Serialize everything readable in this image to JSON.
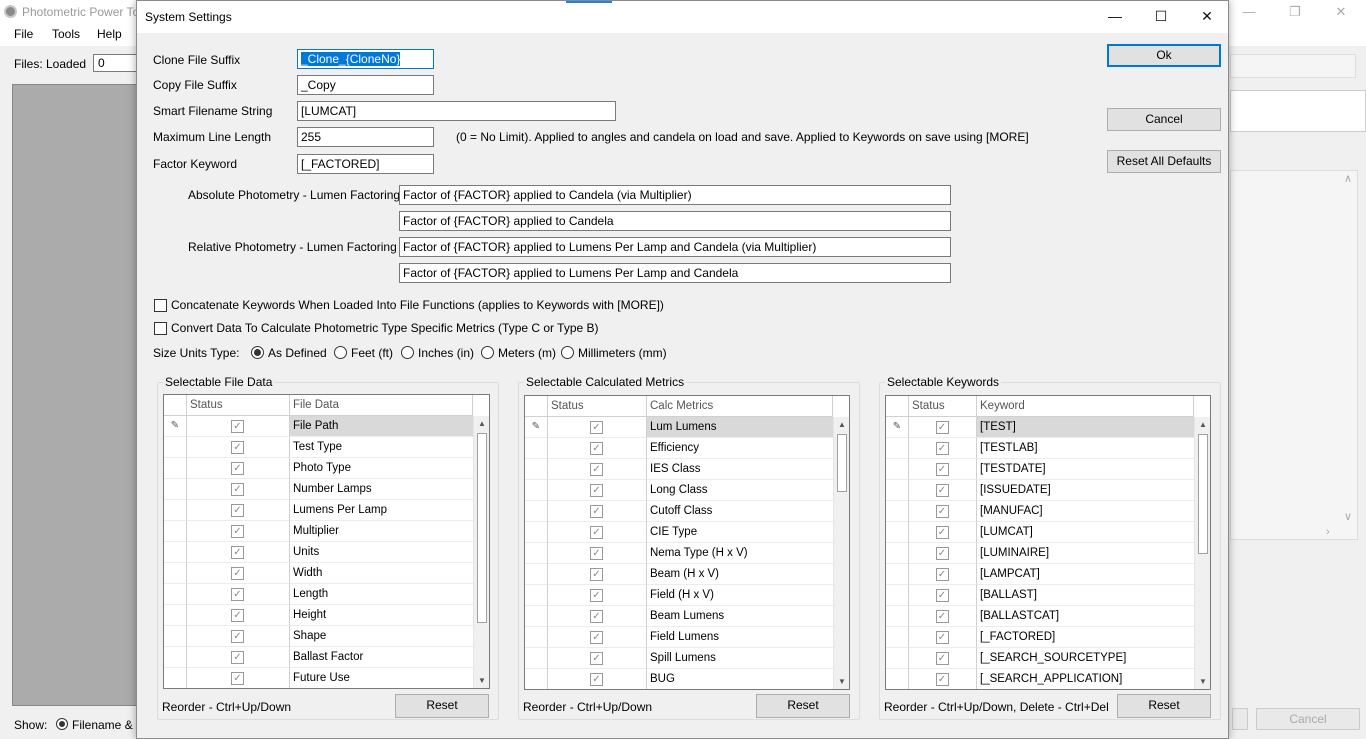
{
  "bg_app": {
    "title": "Photometric Power To",
    "menu": [
      "File",
      "Tools",
      "Help"
    ],
    "files_loaded_label": "Files: Loaded",
    "files_loaded_value": "0",
    "show_label": "Show:",
    "show_option": "Filename & D",
    "cancel_label": "Cancel"
  },
  "dialog": {
    "title": "System Settings",
    "fields": {
      "clone_suffix_label": "Clone File Suffix",
      "clone_suffix_value": "_Clone_{CloneNo}",
      "copy_suffix_label": "Copy File Suffix",
      "copy_suffix_value": "_Copy",
      "smart_filename_label": "Smart Filename String",
      "smart_filename_value": "[LUMCAT]",
      "max_line_label": "Maximum Line Length",
      "max_line_value": "255",
      "max_line_note": "(0 = No Limit). Applied to angles and candela on load and save. Applied to Keywords on save using [MORE]",
      "factor_keyword_label": "Factor Keyword",
      "factor_keyword_value": "[_FACTORED]",
      "abs_label": "Absolute Photometry  - Lumen Factoring",
      "abs_value_1": "Factor of {FACTOR} applied to Candela (via Multiplier)",
      "abs_value_2": "Factor of {FACTOR} applied to Candela",
      "rel_label": "Relative Photometry - Lumen Factoring",
      "rel_value_1": "Factor of {FACTOR} applied to Lumens Per Lamp and Candela (via Multiplier)",
      "rel_value_2": "Factor of {FACTOR} applied to Lumens Per Lamp and Candela"
    },
    "checkboxes": {
      "concat_label": "Concatenate Keywords When Loaded Into File Functions (applies to Keywords with [MORE])",
      "convert_label": "Convert Data To Calculate Photometric Type Specific Metrics (Type C or Type B)"
    },
    "size_units": {
      "label": "Size Units Type:",
      "options": [
        "As Defined",
        "Feet (ft)",
        "Inches (in)",
        "Meters (m)",
        "Millimeters (mm)"
      ],
      "selected": "As Defined"
    },
    "buttons": {
      "ok": "Ok",
      "cancel": "Cancel",
      "reset_all": "Reset All Defaults"
    },
    "file_data": {
      "title": "Selectable File Data",
      "col_status": "Status",
      "col_name": "File Data",
      "rows": [
        "File Path",
        "Test Type",
        "Photo Type",
        "Number Lamps",
        "Lumens Per Lamp",
        "Multiplier",
        "Units",
        "Width",
        "Length",
        "Height",
        "Shape",
        "Ballast Factor",
        "Future Use"
      ],
      "hint": "Reorder -  Ctrl+Up/Down",
      "reset": "Reset"
    },
    "calc_metrics": {
      "title": "Selectable Calculated Metrics",
      "col_status": "Status",
      "col_name": "Calc Metrics",
      "rows": [
        "Lum Lumens",
        "Efficiency",
        "IES Class",
        "Long Class",
        "Cutoff Class",
        "CIE Type",
        "Nema Type (H x V)",
        "Beam (H x V)",
        "Field (H x V)",
        "Beam Lumens",
        "Field Lumens",
        "Spill Lumens",
        "BUG"
      ],
      "hint": "Reorder - Ctrl+Up/Down",
      "reset": "Reset"
    },
    "keywords": {
      "title": "Selectable Keywords",
      "col_status": "Status",
      "col_name": "Keyword",
      "rows": [
        "[TEST]",
        "[TESTLAB]",
        "[TESTDATE]",
        "[ISSUEDATE]",
        "[MANUFAC]",
        "[LUMCAT]",
        "[LUMINAIRE]",
        "[LAMPCAT]",
        "[BALLAST]",
        "[BALLASTCAT]",
        "[_FACTORED]",
        "[_SEARCH_SOURCETYPE]",
        "[_SEARCH_APPLICATION]"
      ],
      "hint": "Reorder - Ctrl+Up/Down, Delete - Ctrl+Del",
      "reset": "Reset"
    }
  }
}
